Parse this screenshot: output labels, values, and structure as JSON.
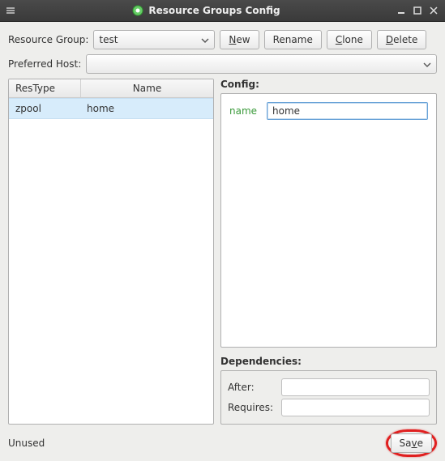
{
  "window": {
    "title": "Resource Groups Config"
  },
  "toolbar": {
    "resource_group_label": "Resource Group:",
    "resource_group_value": "test",
    "new_label": "New",
    "rename_label": "Rename",
    "clone_label": "Clone",
    "delete_label": "Delete",
    "preferred_host_label": "Preferred Host:",
    "preferred_host_value": ""
  },
  "list": {
    "col_restype": "ResType",
    "col_name": "Name",
    "rows": [
      {
        "restype": "zpool",
        "name": "home"
      }
    ]
  },
  "config": {
    "section_label": "Config:",
    "name_label": "name",
    "name_value": "home"
  },
  "deps": {
    "section_label": "Dependencies:",
    "after_label": "After:",
    "after_value": "",
    "requires_label": "Requires:",
    "requires_value": ""
  },
  "footer": {
    "status": "Unused",
    "save_label": "Save"
  }
}
